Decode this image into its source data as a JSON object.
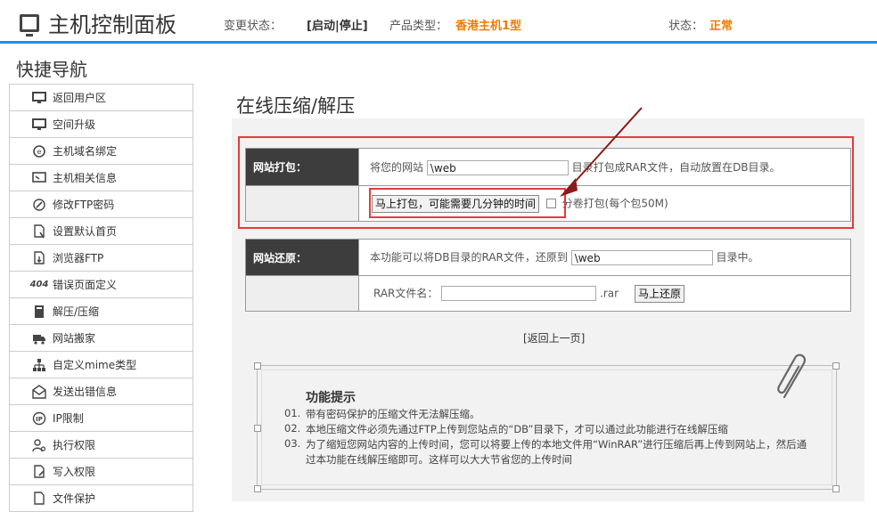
{
  "header": {
    "title": "主机控制面板",
    "change_status_label": "变更状态：",
    "change_actions": "[启动|停止]",
    "product_type_label": "产品类型：",
    "product_type_value": "香港主机1型",
    "status_label": "状态：",
    "status_value": "正常",
    "colors": {
      "accent": "#1e90e6",
      "highlight": "#f07b00"
    }
  },
  "sidebar": {
    "title": "快捷导航",
    "items": [
      {
        "label": "返回用户区",
        "icon": "monitor-icon"
      },
      {
        "label": "空间升级",
        "icon": "monitor-icon"
      },
      {
        "label": "主机域名绑定",
        "icon": "globe-at-icon"
      },
      {
        "label": "主机相关信息",
        "icon": "info-monitor-icon"
      },
      {
        "label": "修改FTP密码",
        "icon": "pen-circle-icon"
      },
      {
        "label": "设置默认首页",
        "icon": "page-cursor-icon"
      },
      {
        "label": "浏览器FTP",
        "icon": "page-download-icon"
      },
      {
        "label": "错误页面定义",
        "icon": "404-icon",
        "icon_text": "404"
      },
      {
        "label": "解压/压缩",
        "icon": "book-icon"
      },
      {
        "label": "网站搬家",
        "icon": "truck-icon"
      },
      {
        "label": "自定义mime类型",
        "icon": "sitemap-icon"
      },
      {
        "label": "发送出错信息",
        "icon": "mail-icon"
      },
      {
        "label": "IP限制",
        "icon": "ip-block-icon"
      },
      {
        "label": "执行权限",
        "icon": "user-gear-icon"
      },
      {
        "label": "写入权限",
        "icon": "page-edit-icon"
      },
      {
        "label": "文件保护",
        "icon": "page-lock-icon"
      }
    ]
  },
  "main": {
    "title": "在线压缩/解压",
    "pack": {
      "header": "网站打包：",
      "prefix": "将您的网站",
      "path_value": "\\web",
      "suffix": "目录打包成RAR文件，自动放置在DB目录。",
      "button": "马上打包，可能需要几分钟的时间",
      "split_label": "分卷打包(每个包50M)"
    },
    "restore": {
      "header": "网站还原：",
      "prefix": "本功能可以将DB目录的RAR文件，还原到",
      "path_value": "\\web",
      "suffix": "目录中。",
      "filename_label": "RAR文件名：",
      "filename_value": "",
      "ext": ".rar",
      "button": "马上还原"
    },
    "back_link": "[返回上一页]",
    "tips": {
      "title": "功能提示",
      "items": [
        {
          "no": "01.",
          "text": "带有密码保护的压缩文件无法解压缩。"
        },
        {
          "no": "02.",
          "text": "本地压缩文件必须先通过FTP上传到您站点的“DB”目录下，才可以通过此功能进行在线解压缩"
        },
        {
          "no": "03.",
          "text": "为了缩短您网站内容的上传时间，您可以将要上传的本地文件用“WinRAR”进行压缩后再上传到网站上，然后通"
        },
        {
          "no": "",
          "text": "过本功能在线解压缩即可。这样可以大大节省您的上传时间"
        }
      ]
    }
  }
}
